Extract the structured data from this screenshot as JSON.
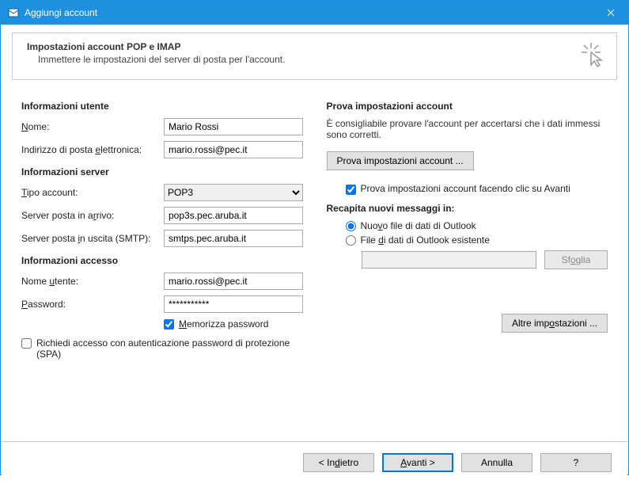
{
  "window": {
    "title": "Aggiungi account"
  },
  "header": {
    "title": "Impostazioni account POP e IMAP",
    "subtitle": "Immettere le impostazioni del server di posta per l'account."
  },
  "left": {
    "user_section": "Informazioni utente",
    "name_label": "Nome:",
    "name_value": "Mario Rossi",
    "email_label": "Indirizzo di posta elettronica:",
    "email_value": "mario.rossi@pec.it",
    "server_section": "Informazioni server",
    "type_label": "Tipo account:",
    "type_value": "POP3",
    "incoming_label": "Server posta in arrivo:",
    "incoming_value": "pop3s.pec.aruba.it",
    "outgoing_label": "Server posta in uscita (SMTP):",
    "outgoing_value": "smtps.pec.aruba.it",
    "login_section": "Informazioni accesso",
    "username_label": "Nome utente:",
    "username_value": "mario.rossi@pec.it",
    "password_label": "Password:",
    "password_value": "***********",
    "remember_label": "Memorizza password",
    "spa_label": "Richiedi accesso con autenticazione password di protezione (SPA)"
  },
  "right": {
    "test_section": "Prova impostazioni account",
    "test_desc": "È consigliabile provare l'account per accertarsi che i dati immessi sono corretti.",
    "test_button": "Prova impostazioni account ...",
    "auto_test_label": "Prova impostazioni account facendo clic su Avanti",
    "deliver_section": "Recapita nuovi messaggi in:",
    "radio_new": "Nuovo file di dati di Outlook",
    "radio_existing": "File di dati di Outlook esistente",
    "browse_button": "Sfoglia",
    "more_button": "Altre impostazioni ..."
  },
  "footer": {
    "back": "< Indietro",
    "next": "Avanti >",
    "cancel": "Annulla",
    "help": "?"
  }
}
